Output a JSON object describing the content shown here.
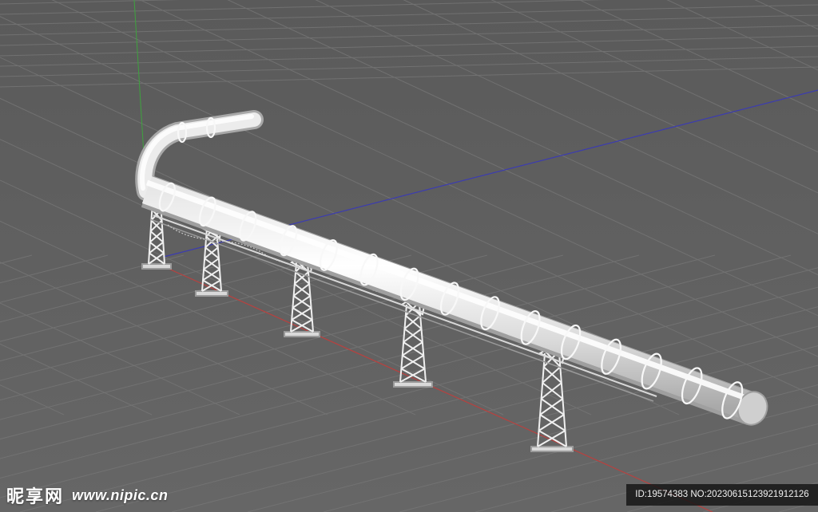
{
  "watermark": {
    "brand": "昵享网",
    "url": "www.nipic.cn"
  },
  "image_id": "ID:19574383 NO:20230615123921912126",
  "scene": {
    "description_colors": {
      "background": "#5f5f5f",
      "grid_line": "#757575",
      "x_axis": "#b8413f",
      "y_axis": "#3ea33e",
      "z_axis": "#3c3cb0",
      "pipe_light": "#f2f2f2",
      "pipe_shadow": "#b8b8b8"
    }
  }
}
